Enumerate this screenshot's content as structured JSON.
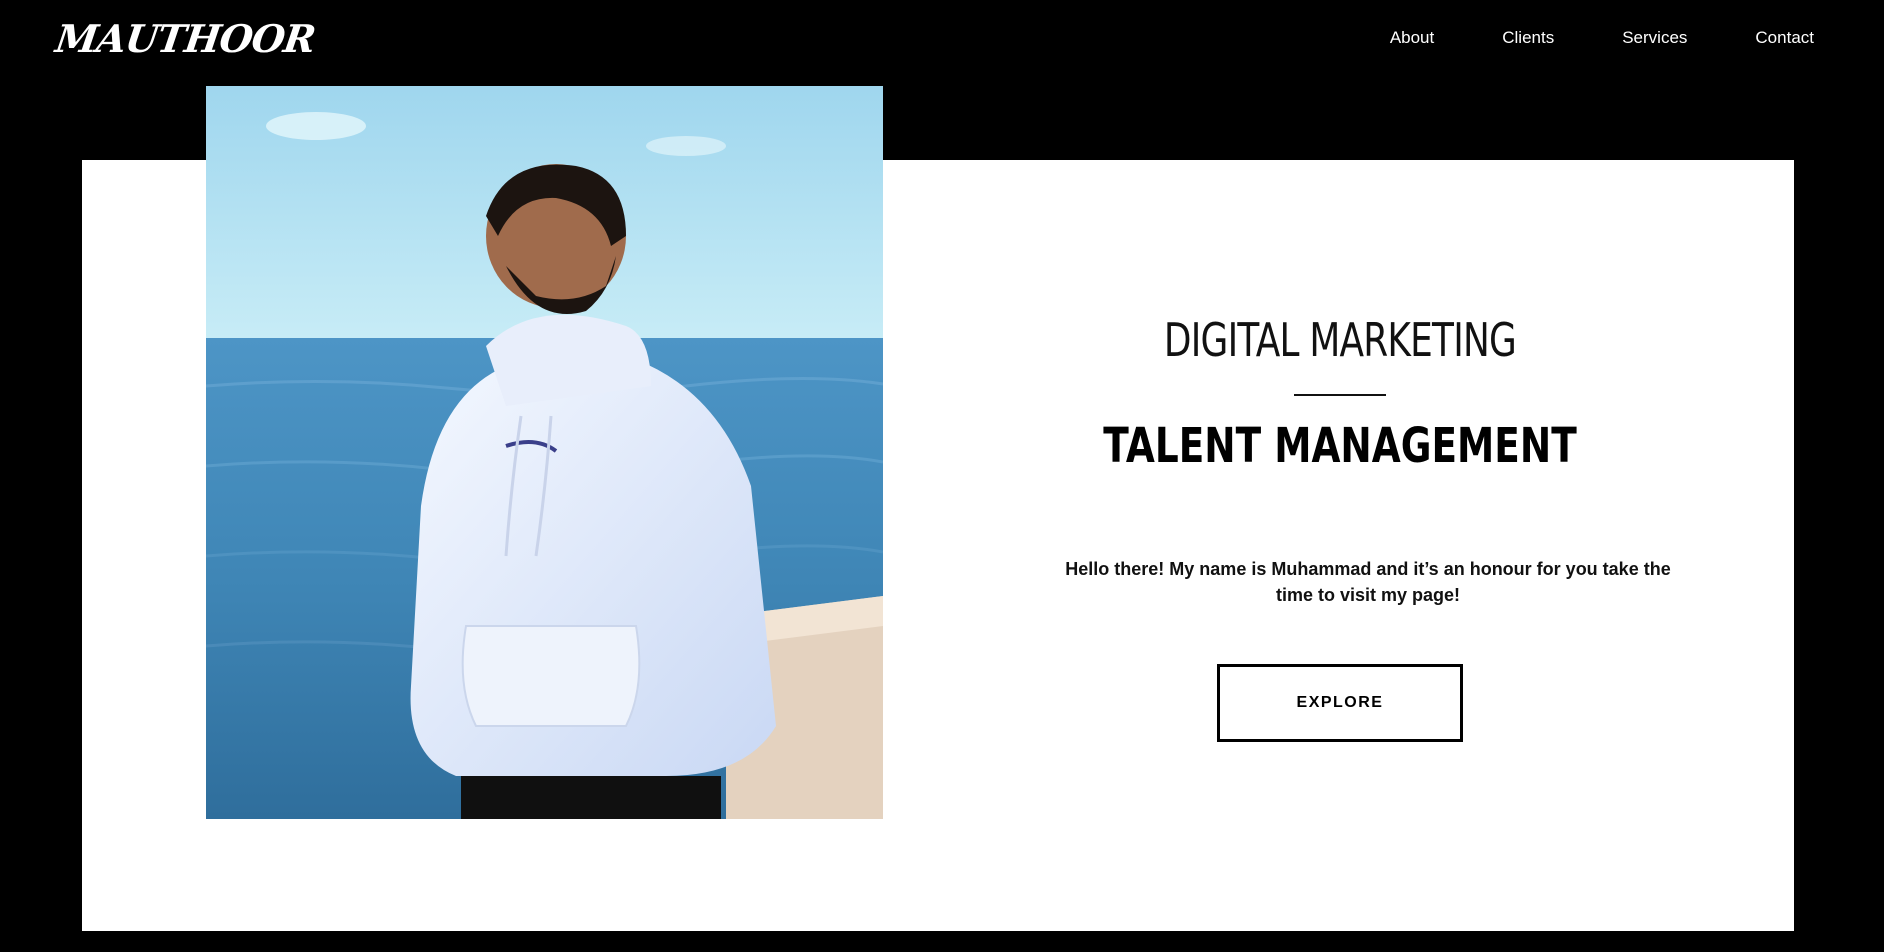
{
  "header": {
    "logo": "MAUTHOOR",
    "nav": [
      "About",
      "Clients",
      "Services",
      "Contact"
    ]
  },
  "hero": {
    "title_primary": "DIGITAL MARKETING",
    "title_secondary": "TALENT MANAGEMENT",
    "intro": "Hello there! My name is Muhammad and it’s an honour for you take the time to visit my page!",
    "button_label": "EXPLORE"
  },
  "colors": {
    "background": "#000000",
    "panel": "#ffffff",
    "text": "#000000",
    "nav_text": "#ffffff"
  }
}
